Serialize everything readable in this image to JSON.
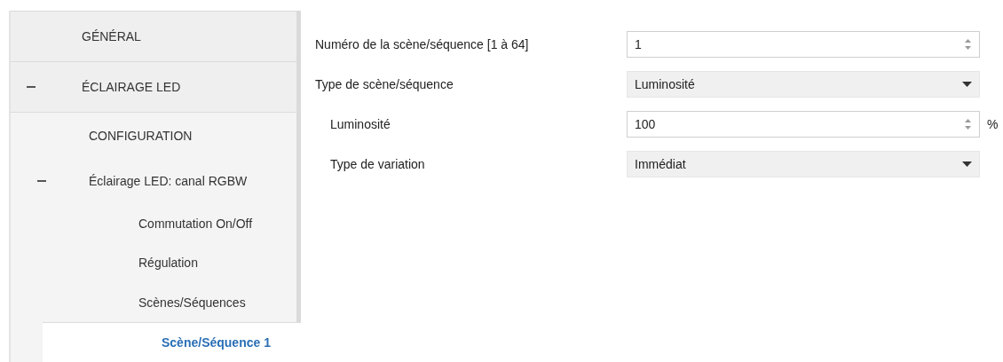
{
  "sidebar": {
    "items": [
      {
        "label": "GÉNÉRAL",
        "selected": false
      },
      {
        "label": "ÉCLAIRAGE LED",
        "selected": false,
        "expanded": true,
        "children": [
          {
            "label": "CONFIGURATION",
            "selected": false
          },
          {
            "label": "Éclairage LED: canal RGBW",
            "selected": false,
            "expanded": true,
            "children": [
              {
                "label": "Commutation On/Off",
                "selected": false
              },
              {
                "label": "Régulation",
                "selected": false
              },
              {
                "label": "Scènes/Séquences",
                "selected": false,
                "children": [
                  {
                    "label": "Scène/Séquence 1",
                    "selected": true
                  }
                ]
              }
            ]
          }
        ]
      }
    ]
  },
  "form": {
    "rows": [
      {
        "label": "Numéro de la scène/séquence [1 à 64]",
        "kind": "spin",
        "value": "1"
      },
      {
        "label": "Type de scène/séquence",
        "kind": "select",
        "value": "Luminosité",
        "children": [
          {
            "label": "Luminosité",
            "kind": "spin",
            "value": "100",
            "unit": "%"
          },
          {
            "label": "Type de variation",
            "kind": "select",
            "value": "Immédiat"
          }
        ]
      }
    ]
  }
}
